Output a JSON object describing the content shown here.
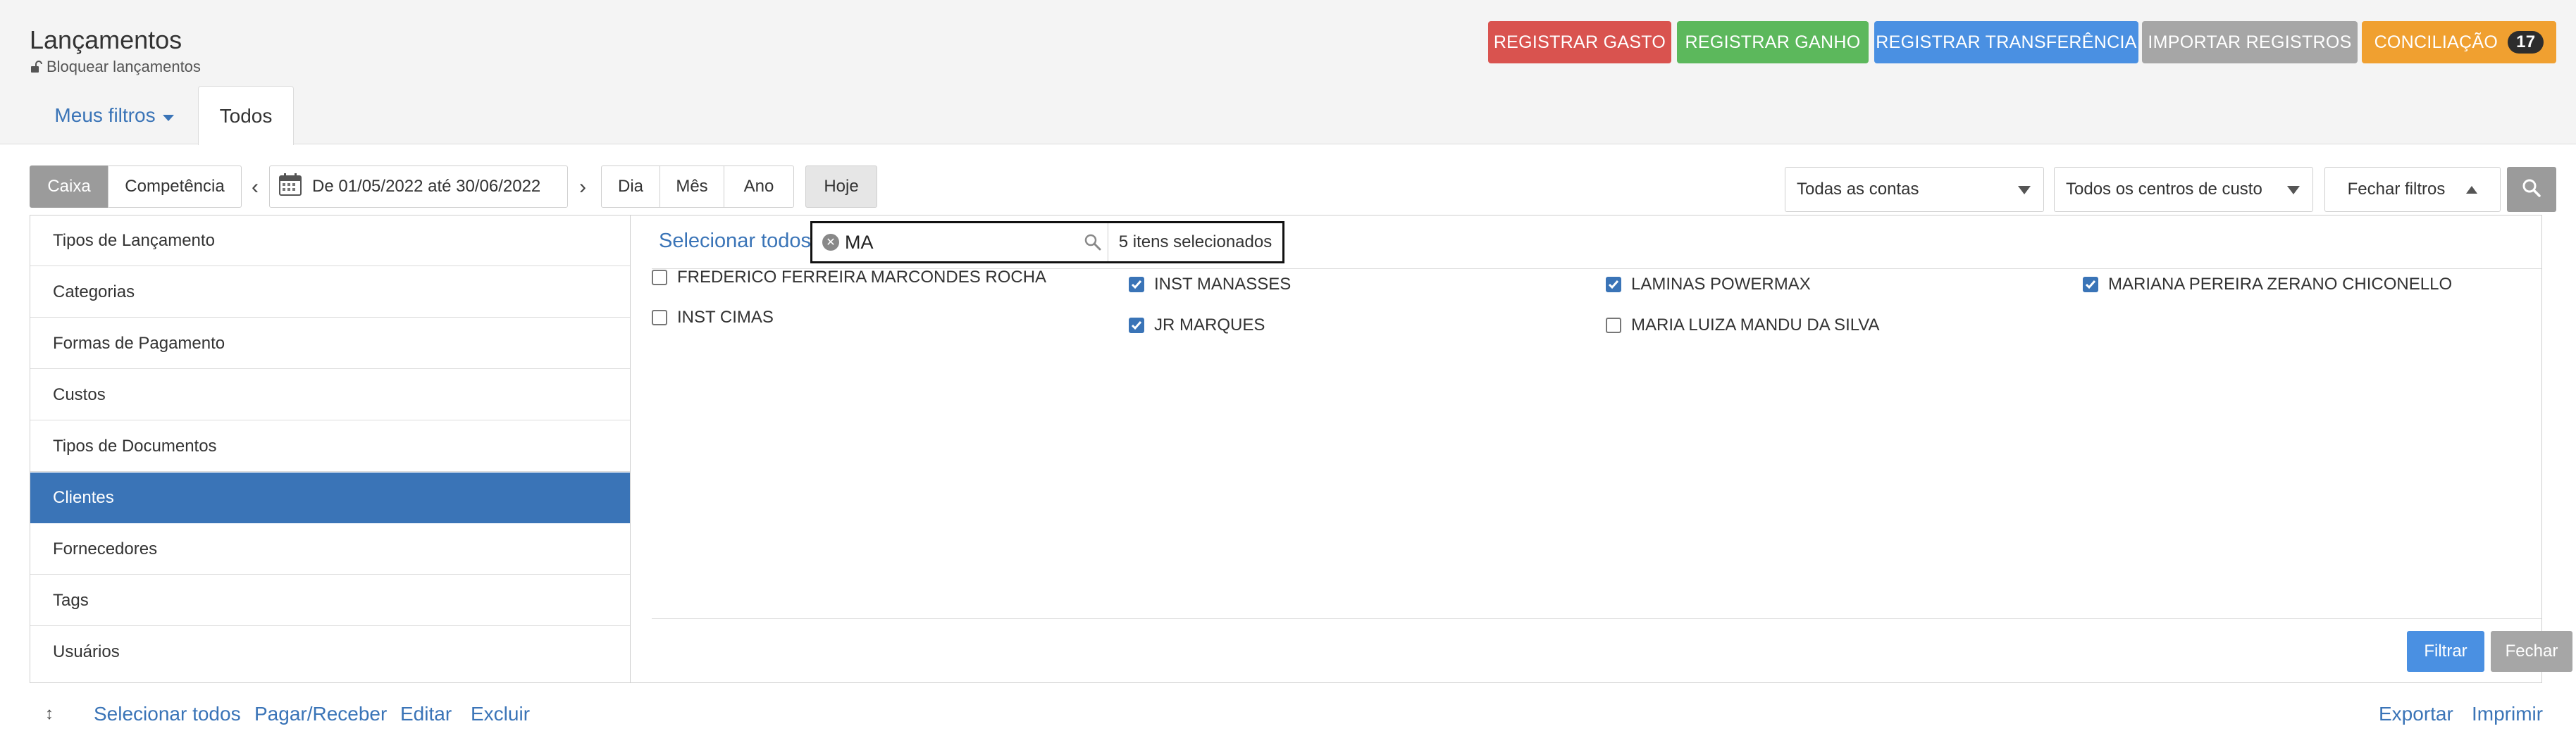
{
  "header": {
    "title": "Lançamentos",
    "lock_label": "Bloquear lançamentos"
  },
  "actions": {
    "gasto": "REGISTRAR GASTO",
    "ganho": "REGISTRAR GANHO",
    "transferencia": "REGISTRAR TRANSFERÊNCIA",
    "importar": "IMPORTAR REGISTROS",
    "conciliacao": "CONCILIAÇÃO",
    "conciliacao_count": "17"
  },
  "tabs": {
    "my_filters": "Meus filtros",
    "all": "Todos"
  },
  "toolbar": {
    "caixa": "Caixa",
    "competencia": "Competência",
    "date_range": "De 01/05/2022 até 30/06/2022",
    "dia": "Dia",
    "mes": "Mês",
    "ano": "Ano",
    "hoje": "Hoje",
    "accounts": "Todas as contas",
    "cost_centers": "Todos os centros de custo",
    "close_filters": "Fechar filtros"
  },
  "categories": [
    {
      "label": "Tipos de Lançamento"
    },
    {
      "label": "Categorias"
    },
    {
      "label": "Formas de Pagamento"
    },
    {
      "label": "Custos"
    },
    {
      "label": "Tipos de Documentos"
    },
    {
      "label": "Clientes"
    },
    {
      "label": "Fornecedores"
    },
    {
      "label": "Tags"
    },
    {
      "label": "Usuários"
    }
  ],
  "filter": {
    "select_all": "Selecionar todos",
    "search_value": "MA",
    "selected_count": "5 itens selecionados",
    "options": [
      {
        "label": "FREDERICO FERREIRA MARCONDES ROCHA",
        "checked": false
      },
      {
        "label": "INST CIMAS",
        "checked": false
      },
      {
        "label": "INST MANASSES",
        "checked": true
      },
      {
        "label": "JR MARQUES",
        "checked": true
      },
      {
        "label": "LAMINAS POWERMAX",
        "checked": true
      },
      {
        "label": "MARIA LUIZA MANDU DA SILVA",
        "checked": false
      },
      {
        "label": "MARIANA PEREIRA ZERANO CHICONELLO",
        "checked": true
      }
    ],
    "filter_button": "Filtrar",
    "close_button": "Fechar"
  },
  "footer": {
    "select_all": "Selecionar todos",
    "pay_receive": "Pagar/Receber",
    "edit": "Editar",
    "delete": "Excluir",
    "export": "Exportar",
    "print": "Imprimir"
  },
  "colors": {
    "primary": "#3a74b7",
    "danger": "#d9534f",
    "success": "#5cb85c",
    "info": "#4a90e2",
    "muted": "#a6a6a6",
    "warning": "#f0a030"
  }
}
